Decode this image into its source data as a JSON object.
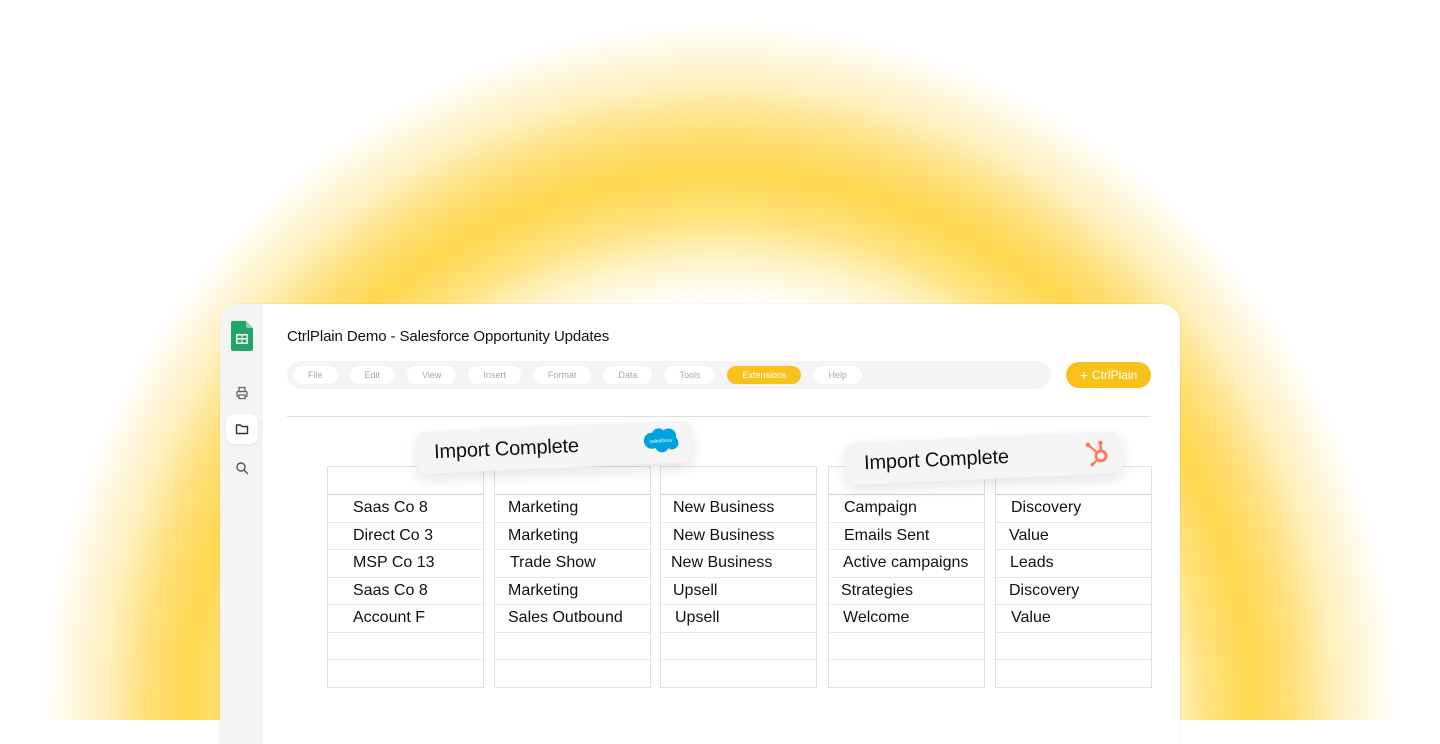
{
  "document": {
    "title": "CtrlPlain Demo - Salesforce Opportunity Updates"
  },
  "menu": [
    "File",
    "Edit",
    "View",
    "Insert",
    "Format",
    "Data",
    "Tools",
    "Extensions",
    "Help"
  ],
  "active_menu": "Extensions",
  "ctrlplain_button": {
    "label": "CtrlPlain"
  },
  "toasts": {
    "salesforce": {
      "message": "Import Complete",
      "logo_text": "salesforce"
    },
    "hubspot": {
      "message": "Import Complete"
    }
  },
  "columns": [
    [
      "Saas Co 8",
      "Direct Co 3",
      "MSP Co 13",
      "Saas Co 8",
      "Account F",
      "",
      ""
    ],
    [
      "Marketing",
      "Marketing",
      "Trade Show",
      "Marketing",
      "Sales Outbound",
      "",
      ""
    ],
    [
      "New Business",
      "New Business",
      "New Business",
      "Upsell",
      "Upsell",
      "",
      ""
    ],
    [
      "Campaign",
      "Emails Sent",
      "Active campaigns",
      "Strategies",
      "Welcome",
      "",
      ""
    ],
    [
      "Discovery",
      "Value",
      "Leads",
      "Discovery",
      "Value",
      "",
      ""
    ]
  ],
  "colors": {
    "accent": "#f9c21b",
    "sheets_green": "#23a566",
    "salesforce_blue": "#00a1e0",
    "hubspot_orange": "#ff7a59"
  }
}
